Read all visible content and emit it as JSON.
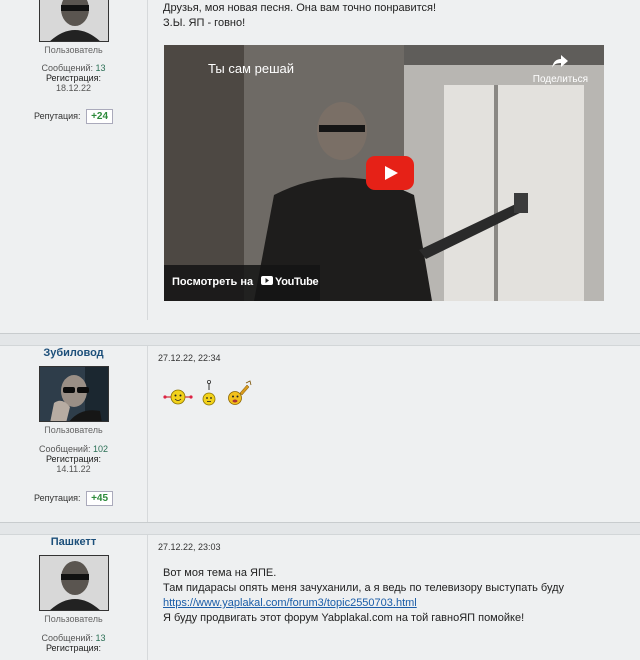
{
  "posts": [
    {
      "role": "Пользователь",
      "posts_label": "Сообщений:",
      "posts_count": "13",
      "reg_label": "Регистрация:",
      "reg_date": "18.12.22",
      "rep_label": "Репутация:",
      "rep_value": "+24",
      "lines": [
        "Друзья, моя новая песня. Она вам точно понравится!",
        "З.Ы. ЯП - говно!"
      ],
      "video": {
        "title": "Ты сам решай",
        "share_label": "Поделиться",
        "watch_label": "Посмотреть на",
        "youtube_label": "YouTube"
      }
    },
    {
      "username": "Зубиловод",
      "timestamp": "27.12.22, 22:34",
      "role": "Пользователь",
      "posts_label": "Сообщений:",
      "posts_count": "102",
      "reg_label": "Регистрация:",
      "reg_date": "14.11.22",
      "rep_label": "Репутация:",
      "rep_value": "+45"
    },
    {
      "username": "Пашкетт",
      "timestamp": "27.12.22, 23:03",
      "role": "Пользователь",
      "posts_label": "Сообщений:",
      "posts_count": "13",
      "reg_label": "Регистрация:",
      "lines": [
        "Вот моя тема на ЯПЕ.",
        "Там пидарасы опять меня зачуханили, а я ведь по телевизору выступать буду",
        "https://www.yaplakal.com/forum3/topic2550703.html",
        "Я буду продвигать этот форум Yabplakal.com на той гавноЯП помойке!"
      ]
    }
  ],
  "colors": {
    "username": "#1c4f7a",
    "reputation": "#2c8a3a",
    "link": "#1b5da8",
    "youtube_red": "#e62117"
  }
}
